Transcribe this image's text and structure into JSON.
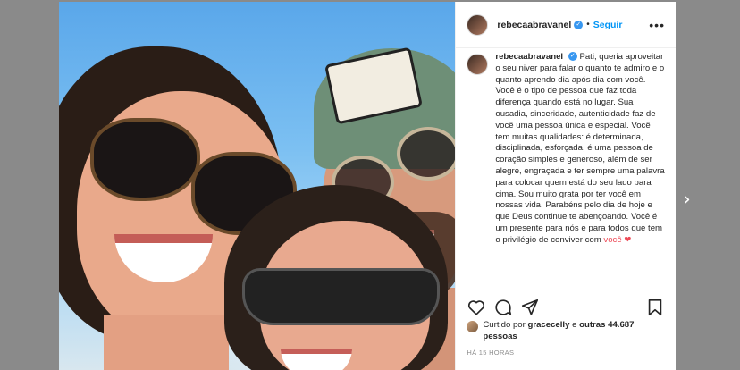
{
  "post": {
    "username": "rebecaabravanel",
    "follow_label": "Seguir",
    "dot": "•",
    "verified_glyph": "✓",
    "more_glyph": "•••"
  },
  "caption": {
    "username": "rebecaabravanel",
    "text": "Pati, queria aproveitar o seu niver para falar o quanto te admiro e o quanto aprendo dia após dia com você. Você é o tipo de pessoa que faz toda diferença quando está no lugar. Sua ousadia, sinceridade, autenticidade faz de você uma pessoa única e especial. Você tem muitas qualidades: é determinada, disciplinada, esforçada, é uma pessoa de coração simples e generoso, além de ser alegre, engraçada e ter sempre uma palavra para colocar quem está do seu lado para cima. Sou muito grata por ter você em nossas vida. Parabéns pelo dia de hoje e que Deus continue te abençoando. Você é um presente para nós e para todos que tem o privilégio de conviver com",
    "tail": "você ❤"
  },
  "likes": {
    "prefix": "Curtido por",
    "first_user": "gracecelly",
    "connector": "e",
    "others": "outras 44.687 pessoas"
  },
  "timestamp": "HÁ 15 HORAS",
  "nav": {
    "next_glyph": "›"
  },
  "icons": {
    "like": "heart-icon",
    "comment": "comment-icon",
    "share": "share-icon",
    "save": "bookmark-icon",
    "more": "more-options-icon",
    "next": "chevron-right-icon"
  },
  "colors": {
    "follow": "#0095f6",
    "verified": "#3897f0",
    "text": "#262626",
    "muted": "#8e8e8e"
  }
}
